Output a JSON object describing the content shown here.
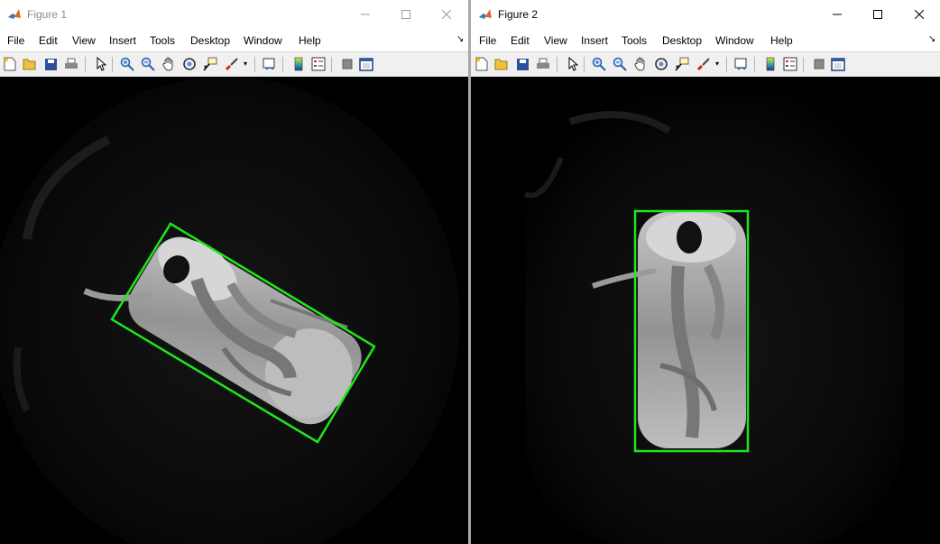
{
  "figure1": {
    "title": "Figure 1",
    "menu": [
      "File",
      "Edit",
      "View",
      "Insert",
      "Tools",
      "Desktop",
      "Window",
      "Help"
    ],
    "box_color": "#1ee51e"
  },
  "figure2": {
    "title": "Figure 2",
    "menu": [
      "File",
      "Edit",
      "View",
      "Insert",
      "Tools",
      "Desktop",
      "Window",
      "Help"
    ],
    "box_color": "#1ee51e"
  },
  "toolbar_icons": [
    "new-figure-icon",
    "open-file-icon",
    "save-icon",
    "print-icon",
    "edit-plot-icon",
    "zoom-in-icon",
    "zoom-out-icon",
    "pan-icon",
    "rotate-3d-icon",
    "data-cursor-icon",
    "brush-icon",
    "link-plot-icon",
    "insert-colorbar-icon",
    "insert-legend-icon",
    "hide-plot-tools-icon",
    "show-plot-tools-icon"
  ],
  "caption_icons": [
    "minimize-icon",
    "maximize-icon",
    "close-icon"
  ]
}
